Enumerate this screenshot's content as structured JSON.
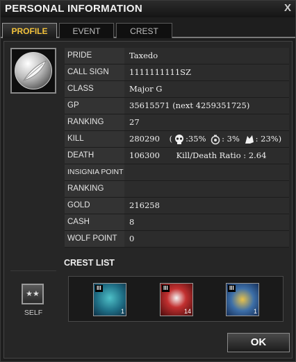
{
  "window": {
    "title": "PERSONAL INFORMATION",
    "close_label": "X"
  },
  "tabs": [
    {
      "label": "PROFILE",
      "active": true
    },
    {
      "label": "EVENT",
      "active": false
    },
    {
      "label": "CREST",
      "active": false
    }
  ],
  "profile": {
    "rows": [
      {
        "label": "PRIDE",
        "value": "Taxedo"
      },
      {
        "label": "CALL SIGN",
        "value": "1111111111SZ"
      },
      {
        "label": "CLASS",
        "value": "Major G"
      },
      {
        "label": "GP",
        "value": "35615571 (next 4259351725)"
      },
      {
        "label": "RANKING",
        "value": "27"
      },
      {
        "label": "KILL",
        "value": ""
      },
      {
        "label": "DEATH",
        "value": ""
      },
      {
        "label": "INSIGNIA POINT",
        "value": ""
      },
      {
        "label": "RANKING",
        "value": ""
      },
      {
        "label": "GOLD",
        "value": "216258"
      },
      {
        "label": "CASH",
        "value": "8"
      },
      {
        "label": "WOLF POINT",
        "value": "0"
      }
    ],
    "kill": {
      "total": "280290",
      "open_paren": "(",
      "skull_pct": ":35%",
      "grenade_pct": ": 3%",
      "wolf_pct": ": 23%)",
      "icons": [
        "skull-icon",
        "grenade-icon",
        "wolf-icon"
      ]
    },
    "death": {
      "total": "106300",
      "ratio_text": "Kill/Death Ratio : 2.64"
    }
  },
  "crest_list": {
    "title": "CREST LIST",
    "self_label": "SELF",
    "self_icon": "★★",
    "items": [
      {
        "tier": "III",
        "count": "1",
        "icon": "wolf-crest-icon"
      },
      {
        "tier": "III",
        "count": "14",
        "icon": "medic-crest-icon"
      },
      {
        "tier": "III",
        "count": "1",
        "icon": "grenade-crest-icon"
      }
    ]
  },
  "actions": {
    "ok_label": "OK"
  }
}
